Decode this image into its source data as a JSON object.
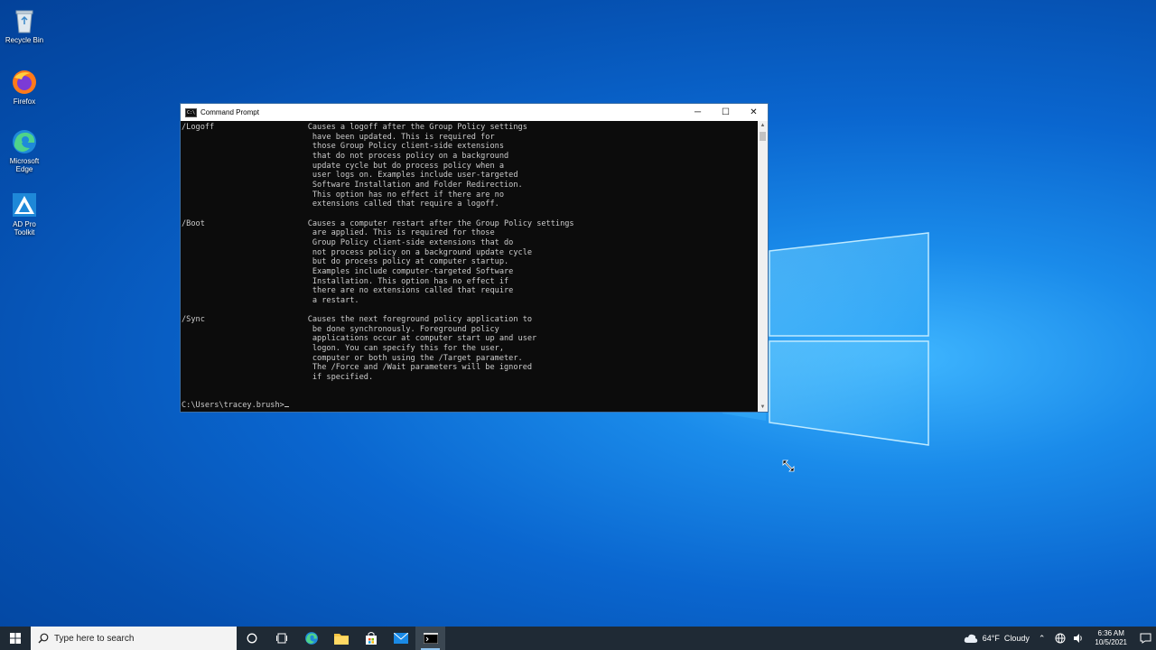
{
  "desktop": {
    "icons": [
      {
        "label": "Recycle Bin"
      },
      {
        "label": "Firefox"
      },
      {
        "label": "Microsoft Edge"
      },
      {
        "label": "AD Pro Toolkit"
      }
    ]
  },
  "window": {
    "title": "Command Prompt",
    "app_icon_text": "C:\\",
    "controls": {
      "minimize": "─",
      "maximize": "☐",
      "close": "✕"
    },
    "output": "/Logoff                    Causes a logoff after the Group Policy settings\n                            have been updated. This is required for\n                            those Group Policy client-side extensions\n                            that do not process policy on a background\n                            update cycle but do process policy when a\n                            user logs on. Examples include user-targeted\n                            Software Installation and Folder Redirection.\n                            This option has no effect if there are no\n                            extensions called that require a logoff.\n\n/Boot                      Causes a computer restart after the Group Policy settings\n                            are applied. This is required for those\n                            Group Policy client-side extensions that do\n                            not process policy on a background update cycle\n                            but do process policy at computer startup.\n                            Examples include computer-targeted Software\n                            Installation. This option has no effect if\n                            there are no extensions called that require\n                            a restart.\n\n/Sync                      Causes the next foreground policy application to\n                            be done synchronously. Foreground policy\n                            applications occur at computer start up and user\n                            logon. You can specify this for the user,\n                            computer or both using the /Target parameter.\n                            The /Force and /Wait parameters will be ignored\n                            if specified.",
    "prompt": "C:\\Users\\tracey.brush>"
  },
  "taskbar": {
    "search_placeholder": "Type here to search",
    "weather": {
      "temp": "64°F",
      "condition": "Cloudy"
    },
    "clock": {
      "time": "6:36 AM",
      "date": "10/5/2021"
    }
  }
}
